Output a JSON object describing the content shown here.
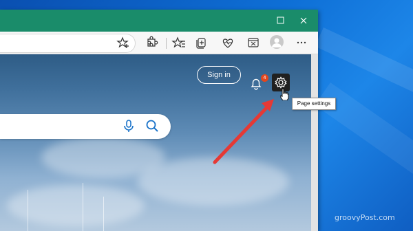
{
  "window": {
    "restore_glyph": "❐",
    "close_glyph": "✕"
  },
  "toolbar": {
    "icons": [
      "favorite-add-icon",
      "extensions-icon",
      "favorites-icon",
      "collections-icon",
      "health-icon",
      "immersive-reader-icon",
      "profile-icon",
      "more-icon"
    ]
  },
  "page": {
    "signin_label": "Sign in",
    "notification_count": "4",
    "settings_tooltip": "Page settings"
  },
  "colors": {
    "titlebar": "#1a8c6a",
    "arrow": "#e53935",
    "badge": "#e2461d"
  },
  "watermark": "groovyPost.com"
}
